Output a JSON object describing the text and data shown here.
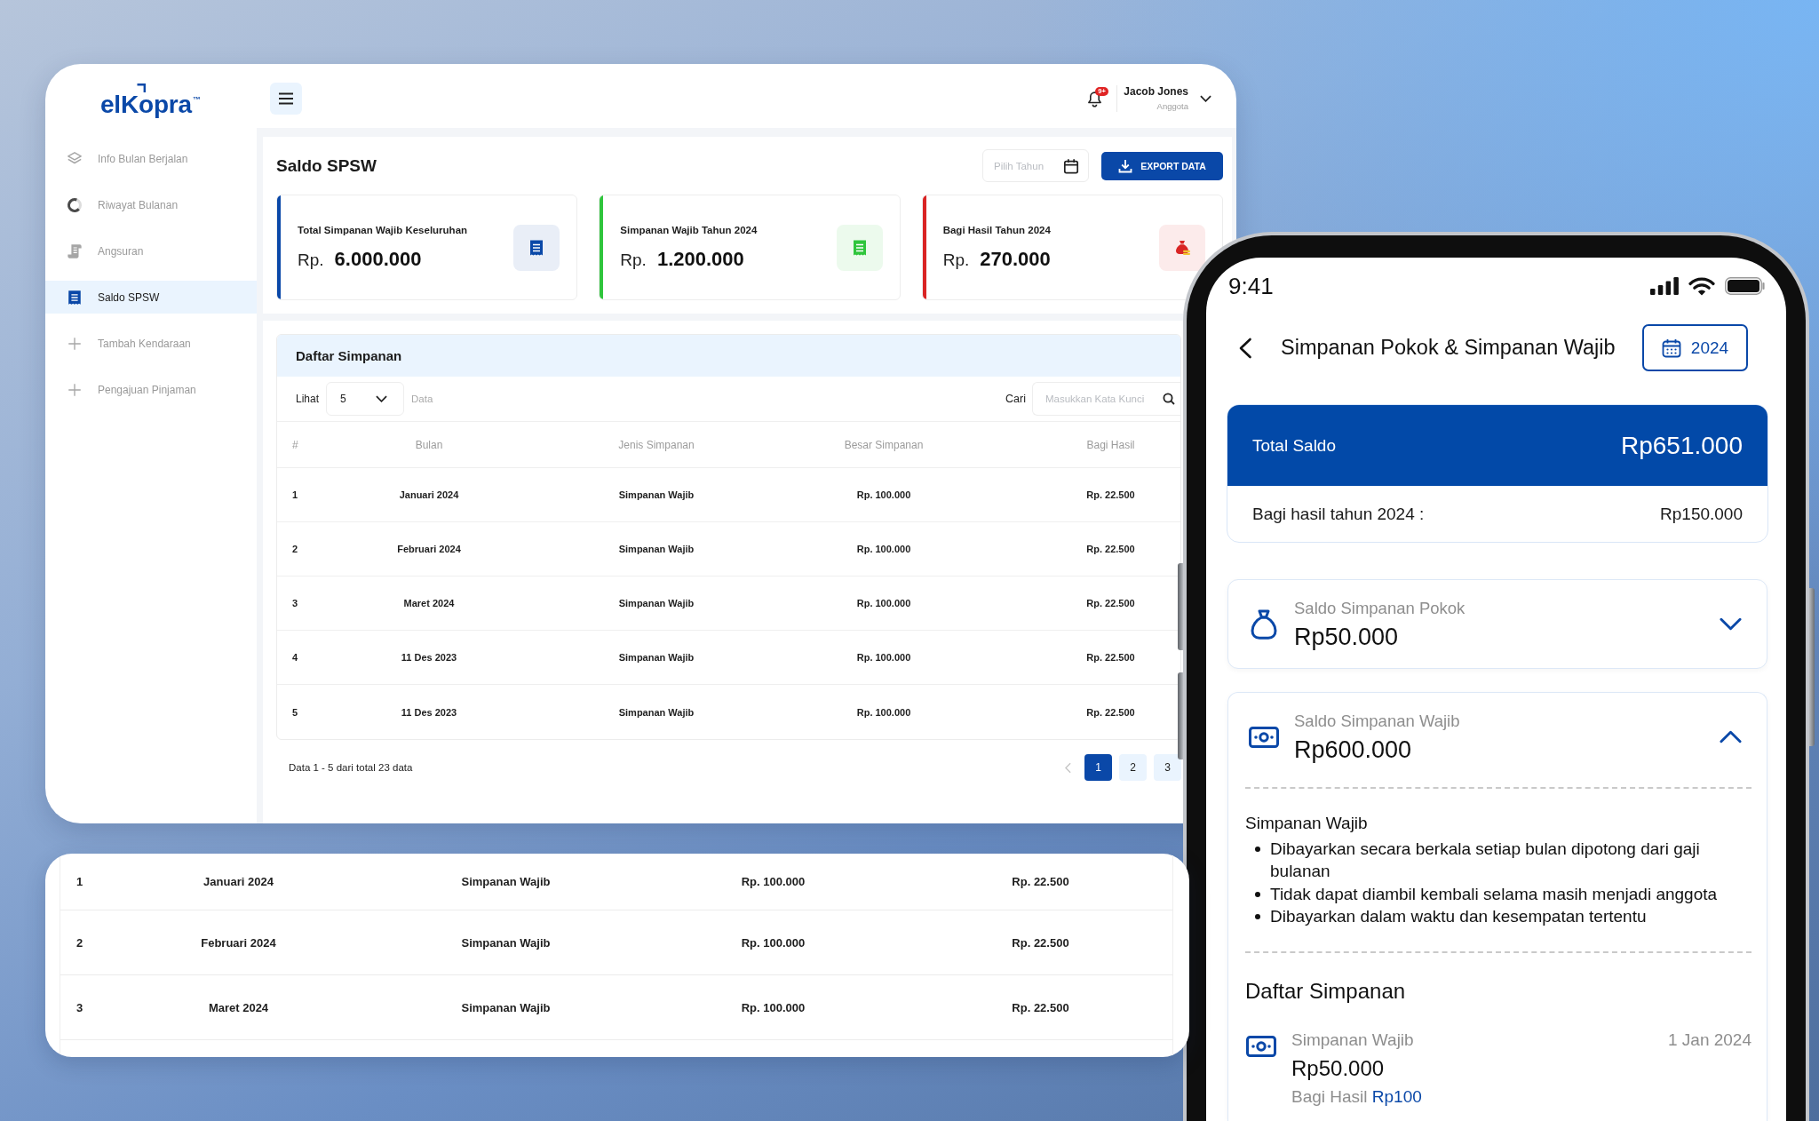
{
  "dashboard": {
    "logo": "elKopra$^{™}$",
    "sidebar": {
      "items": [
        {
          "label": "Info Bulan Berjalan",
          "selected": false
        },
        {
          "label": "Riwayat Bulanan",
          "selected": false
        },
        {
          "label": "Angsuran",
          "selected": false
        },
        {
          "label": "Saldo SPSW",
          "selected": true
        },
        {
          "label": "Tambah Kendaraan",
          "selected": false
        },
        {
          "label": "Pengajuan Pinjaman",
          "selected": false
        }
      ]
    },
    "header": {
      "notification_badge": "9+",
      "user_name": "Jacob Jones",
      "user_role": "Anggota"
    },
    "page_title": "Saldo SPSW",
    "year_field": {
      "placeholder": "Pilih Tahun"
    },
    "export_button": "EXPORT DATA",
    "stat_cards": [
      {
        "label": "Total Simpanan Wajib Keseluruhan",
        "currency": "Rp.",
        "value": "6.000.000",
        "color": "#0a48a8"
      },
      {
        "label": "Simpanan Wajib Tahun 2024",
        "currency": "Rp.",
        "value": "1.200.000",
        "color": "#2fc53c"
      },
      {
        "label": "Bagi Hasil Tahun 2024",
        "currency": "Rp.",
        "value": "270.000",
        "color": "#d92424"
      }
    ],
    "table": {
      "title": "Daftar Simpanan",
      "page_size_label": "Lihat",
      "page_size": "5",
      "page_size_suffix": "Data",
      "search_label": "Cari",
      "search_field": {
        "placeholder": "Masukkan Kata Kunci"
      },
      "columns": [
        "#",
        "Bulan",
        "Jenis Simpanan",
        "Besar Simpanan",
        "Bagi Hasil"
      ],
      "rows": [
        [
          "1",
          "Januari 2024",
          "Simpanan Wajib",
          "Rp. 100.000",
          "Rp. 22.500"
        ],
        [
          "2",
          "Februari 2024",
          "Simpanan Wajib",
          "Rp. 100.000",
          "Rp. 22.500"
        ],
        [
          "3",
          "Maret 2024",
          "Simpanan Wajib",
          "Rp. 100.000",
          "Rp. 22.500"
        ],
        [
          "4",
          "11 Des 2023",
          "Simpanan Wajib",
          "Rp. 100.000",
          "Rp. 22.500"
        ],
        [
          "5",
          "11 Des 2023",
          "Simpanan Wajib",
          "Rp. 100.000",
          "Rp. 22.500"
        ]
      ],
      "summary": "Data 1 - 5 dari total 23 data",
      "pages": [
        {
          "label": "1",
          "selected": true
        },
        {
          "label": "2",
          "selected": false
        },
        {
          "label": "3",
          "selected": false
        }
      ]
    }
  },
  "zoomed_table": {
    "rows": [
      [
        "1",
        "Januari 2024",
        "Simpanan Wajib",
        "Rp. 100.000",
        "Rp. 22.500"
      ],
      [
        "2",
        "Februari 2024",
        "Simpanan Wajib",
        "Rp. 100.000",
        "Rp. 22.500"
      ],
      [
        "3",
        "Maret 2024",
        "Simpanan Wajib",
        "Rp. 100.000",
        "Rp. 22.500"
      ]
    ]
  },
  "phone": {
    "status_bar": {
      "time": "9:41"
    },
    "title": "Simpanan Pokok & Simpanan Wajib",
    "year_button": "2024",
    "total_card": {
      "label": "Total Saldo",
      "value": "Rp651.000",
      "share_label": "Bagi hasil tahun 2024 :",
      "share_value": "Rp150.000"
    },
    "balances": [
      {
        "label": "Saldo Simpanan Pokok",
        "value": "Rp50.000",
        "expanded": false
      },
      {
        "label": "Saldo Simpanan Wajib",
        "value": "Rp600.000",
        "expanded": true,
        "details_title": "Simpanan Wajib",
        "details": [
          "Dibayarkan secara berkala setiap bulan dipotong dari gaji bulanan",
          "Tidak dapat diambil kembali selama masih menjadi anggota",
          "Dibayarkan dalam waktu dan kesempatan tertentu"
        ],
        "list_title": "Daftar Simpanan",
        "entries": [
          {
            "type": "Simpanan Wajib",
            "date": "1 Jan 2024",
            "amount": "Rp50.000",
            "share_label": "Bagi Hasil",
            "share_value": "Rp100"
          }
        ]
      }
    ]
  }
}
